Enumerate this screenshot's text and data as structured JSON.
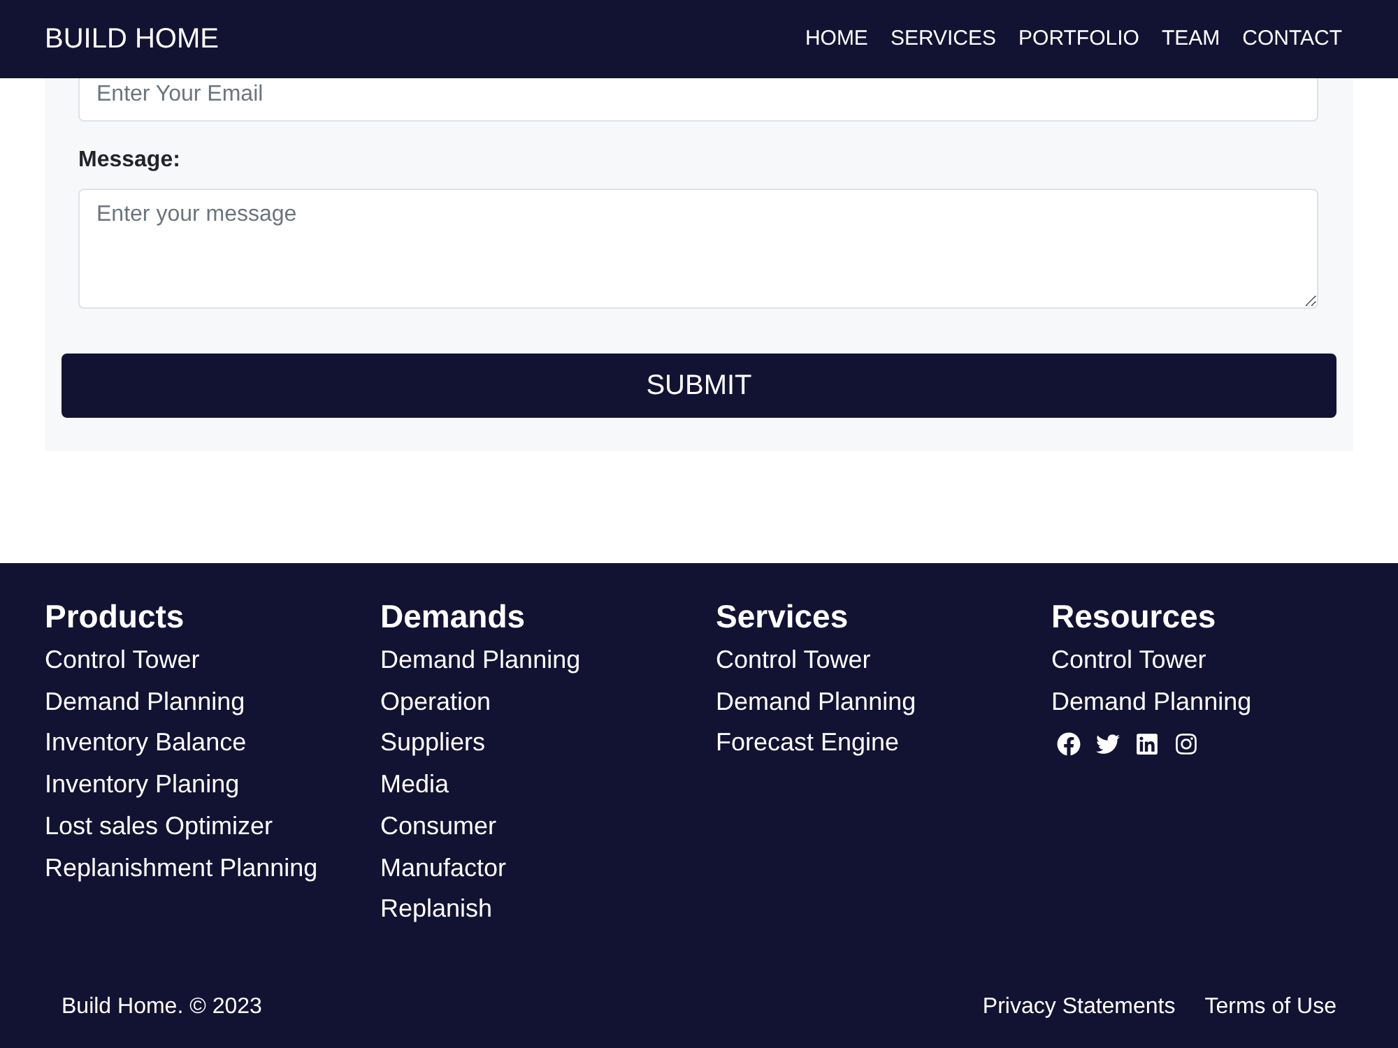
{
  "navbar": {
    "brand": "BUILD HOME",
    "links": [
      {
        "label": "HOME"
      },
      {
        "label": "SERVICES"
      },
      {
        "label": "PORTFOLIO"
      },
      {
        "label": "TEAM"
      },
      {
        "label": "CONTACT"
      }
    ]
  },
  "contact_form": {
    "email_field": {
      "placeholder": "Enter Your Email"
    },
    "message_field": {
      "label": "Message:",
      "placeholder": "Enter your message"
    },
    "submit_button": "SUBMIT"
  },
  "footer": {
    "columns": [
      {
        "heading": "Products",
        "links": [
          "Control Tower",
          "Demand Planning",
          "Inventory Balance",
          "Inventory Planing",
          "Lost sales Optimizer",
          "Replanishment Planning"
        ]
      },
      {
        "heading": "Demands",
        "links": [
          "Demand Planning",
          "Operation",
          "Suppliers",
          "Media",
          "Consumer",
          "Manufactor",
          "Replanish"
        ]
      },
      {
        "heading": "Services",
        "links": [
          "Control Tower",
          "Demand Planning",
          "Forecast Engine"
        ]
      },
      {
        "heading": "Resources",
        "links": [
          "Control Tower",
          "Demand Planning"
        ],
        "social": [
          {
            "kind": "facebook"
          },
          {
            "kind": "twitter"
          },
          {
            "kind": "linkedin"
          },
          {
            "kind": "instagram"
          }
        ]
      }
    ],
    "copyright": "Build Home. © 2023",
    "legal_links": [
      "Privacy Statements",
      "Terms of Use"
    ]
  }
}
